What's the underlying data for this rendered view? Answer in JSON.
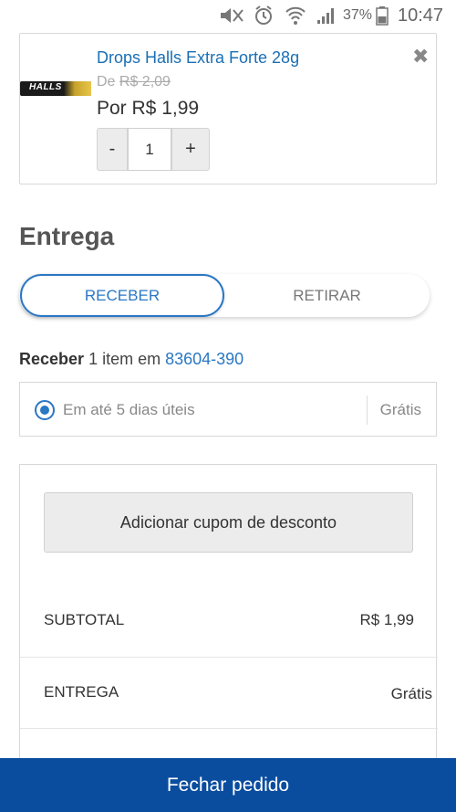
{
  "status_bar": {
    "battery_percent": "37%",
    "time": "10:47",
    "icons": [
      "mute-icon",
      "alarm-icon",
      "wifi-icon",
      "signal-icon",
      "battery-icon"
    ]
  },
  "cart_item": {
    "image_logo_text": "HALLS",
    "name": "Drops Halls Extra Forte 28g",
    "old_price_prefix": "De",
    "old_price": "R$ 2,09",
    "current_price": "Por R$ 1,99",
    "quantity": "1",
    "minus_label": "-",
    "plus_label": "+",
    "remove_icon": "close-icon",
    "remove_glyph": "✖"
  },
  "delivery": {
    "title": "Entrega",
    "options": [
      "RECEBER",
      "RETIRAR"
    ],
    "selected": "RECEBER",
    "summary_bold": "Receber",
    "summary_text": "1 item em",
    "zip": "83604-390",
    "shipping_option": {
      "label": "Em até 5 dias úteis",
      "price": "Grátis"
    }
  },
  "summary": {
    "coupon_button": "Adicionar cupom de desconto",
    "subtotal_label": "SUBTOTAL",
    "subtotal_value": "R$ 1,99",
    "shipping_label": "ENTREGA",
    "shipping_value": "Grátis"
  },
  "checkout_button": "Fechar pedido",
  "colors": {
    "accent": "#2a77c4",
    "link": "#1a6fb5",
    "checkout_bg": "#0a4d9f"
  }
}
